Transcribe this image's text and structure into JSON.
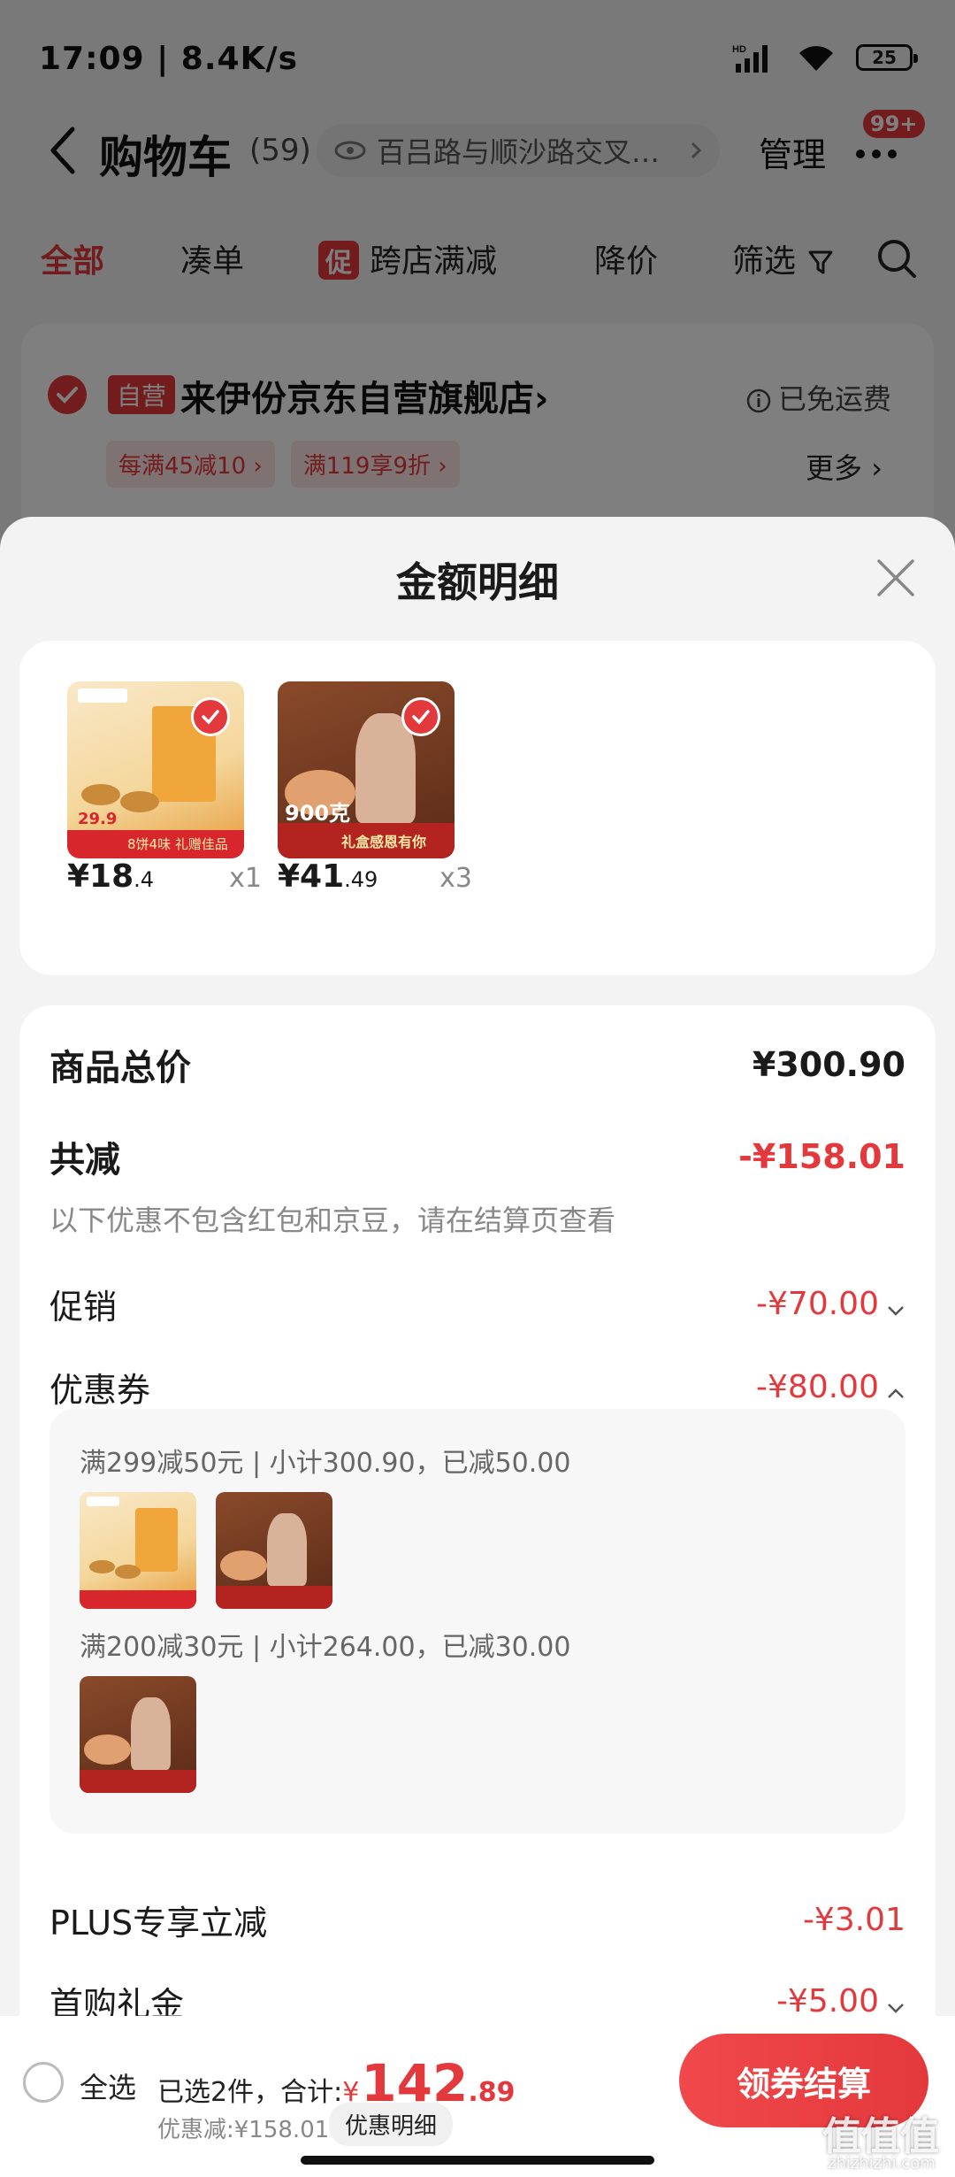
{
  "status_bar": {
    "time": "17:09 | 8.4K/s",
    "battery": "25",
    "signal_label": "HD"
  },
  "nav": {
    "title": "购物车",
    "count": "(59)",
    "location": "百吕路与顺沙路交叉…",
    "manage": "管理",
    "badge": "99+"
  },
  "tabs": [
    "全部",
    "凑单",
    "跨店满减",
    "降价",
    "筛选"
  ],
  "tabs_promo_tag": "促",
  "store": {
    "self_tag": "自营",
    "name": "来伊份京东自营旗舰店",
    "name_chevron": "›",
    "free_shipping": "已免运费",
    "chips": [
      "每满45减10 ›",
      "满119享9折 ›"
    ],
    "more": "更多 ›"
  },
  "sheet": {
    "title": "金额明细",
    "products": [
      {
        "price_int": "¥18",
        "price_dec": ".4",
        "qty": "x1",
        "art": "mooncake-box"
      },
      {
        "price_int": "¥41",
        "price_dec": ".49",
        "qty": "x3",
        "art": "ham-mooncake"
      }
    ],
    "product_art_text": {
      "a_price": "29.9",
      "a_band": "8饼4味 礼赠佳品",
      "b_weight": "900克",
      "b_band": "礼盒感恩有你"
    },
    "total_label": "商品总价",
    "total_value": "¥300.90",
    "reduce_label": "共减",
    "reduce_value": "-¥158.01",
    "reduce_note": "以下优惠不包含红包和京豆，请在结算页查看",
    "promo_label": "促销",
    "promo_value": "-¥70.00",
    "coupon_label": "优惠券",
    "coupon_value": "-¥80.00",
    "coupon_lines": [
      "满299减50元 | 小计300.90，已减50.00",
      "满200减30元 | 小计264.00，已减30.00"
    ],
    "plus_label": "PLUS专享立减",
    "plus_value": "-¥3.01",
    "first_label": "首购礼金",
    "first_value": "-¥5.00"
  },
  "bottom": {
    "select_all": "全选",
    "selected_prefix": "已选2件，合计:",
    "yen": "¥",
    "total_int": "142",
    "total_dec": ".89",
    "discount": "优惠减:¥158.01",
    "detail_button": "优惠明细",
    "checkout": "领券结算"
  },
  "watermark": {
    "main": "值值值",
    "sub": "zhizhizhi.com"
  },
  "colors": {
    "accent": "#e4393c",
    "sheet_bg": "#f3f3f3"
  }
}
